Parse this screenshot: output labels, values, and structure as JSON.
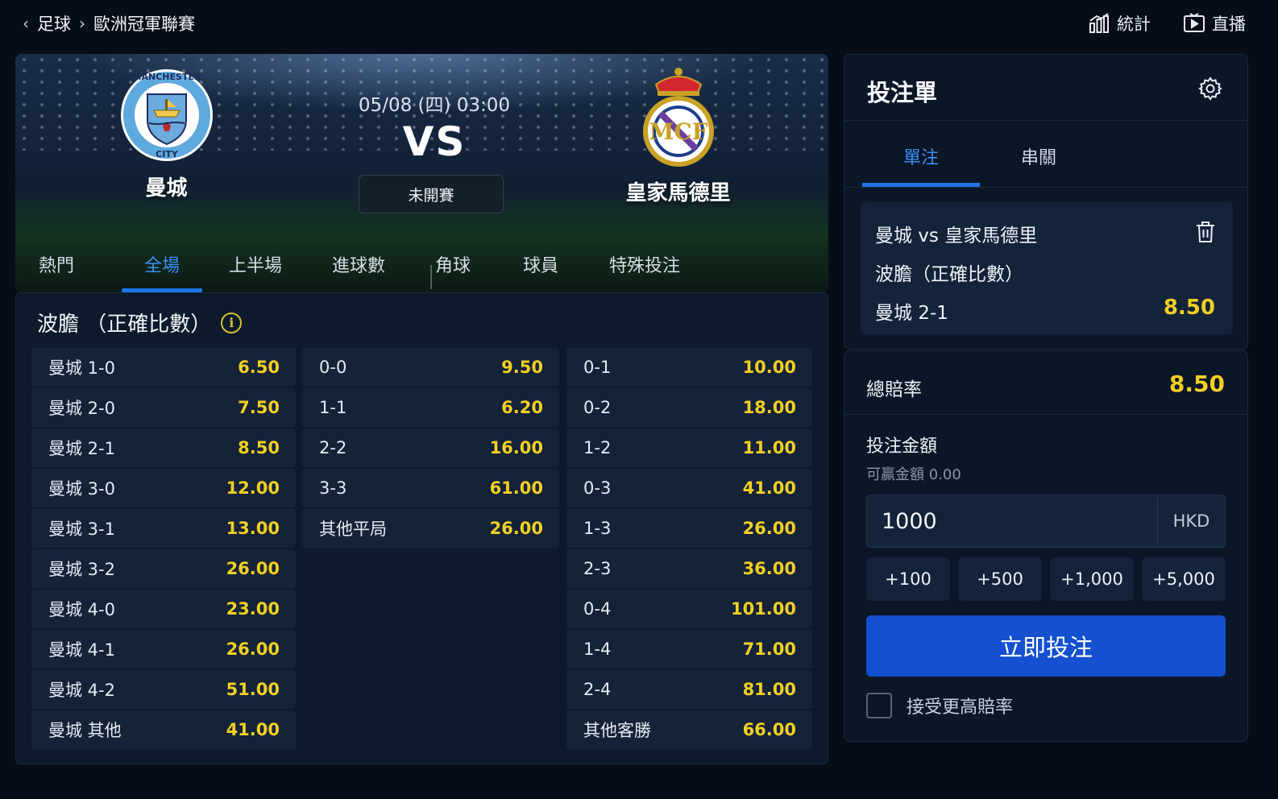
{
  "breadcrumb": {
    "sport": "足球",
    "league": "歐洲冠軍聯賽"
  },
  "top_actions": {
    "stats": "統計",
    "live": "直播"
  },
  "match": {
    "datetime": "05/08 (四) 03:00",
    "vs": "VS",
    "status": "未開賽",
    "home": {
      "name": "曼城",
      "crest_text": "MANCHESTER CITY"
    },
    "away": {
      "name": "皇家馬德里",
      "crest_text": "MCF"
    }
  },
  "market_tabs": [
    {
      "label": "熱門",
      "active": false
    },
    {
      "label": "全場",
      "active": true
    },
    {
      "label": "上半場",
      "active": false
    },
    {
      "label": "進球數",
      "active": false
    },
    {
      "label": "角球",
      "active": false
    },
    {
      "label": "球員",
      "active": false
    },
    {
      "label": "特殊投注",
      "active": false
    }
  ],
  "odds": {
    "title": "波膽 （正確比數）",
    "home_wins": [
      {
        "sel": "曼城 1-0",
        "price": "6.50"
      },
      {
        "sel": "曼城 2-0",
        "price": "7.50"
      },
      {
        "sel": "曼城 2-1",
        "price": "8.50"
      },
      {
        "sel": "曼城 3-0",
        "price": "12.00"
      },
      {
        "sel": "曼城 3-1",
        "price": "13.00"
      },
      {
        "sel": "曼城 3-2",
        "price": "26.00"
      },
      {
        "sel": "曼城 4-0",
        "price": "23.00"
      },
      {
        "sel": "曼城 4-1",
        "price": "26.00"
      },
      {
        "sel": "曼城 4-2",
        "price": "51.00"
      },
      {
        "sel": "曼城 其他",
        "price": "41.00"
      }
    ],
    "draws": [
      {
        "sel": "0-0",
        "price": "9.50"
      },
      {
        "sel": "1-1",
        "price": "6.20"
      },
      {
        "sel": "2-2",
        "price": "16.00"
      },
      {
        "sel": "3-3",
        "price": "61.00"
      },
      {
        "sel": "其他平局",
        "price": "26.00"
      }
    ],
    "away_wins": [
      {
        "sel": "0-1",
        "price": "10.00"
      },
      {
        "sel": "0-2",
        "price": "18.00"
      },
      {
        "sel": "1-2",
        "price": "11.00"
      },
      {
        "sel": "0-3",
        "price": "41.00"
      },
      {
        "sel": "1-3",
        "price": "26.00"
      },
      {
        "sel": "2-3",
        "price": "36.00"
      },
      {
        "sel": "0-4",
        "price": "101.00"
      },
      {
        "sel": "1-4",
        "price": "71.00"
      },
      {
        "sel": "2-4",
        "price": "81.00"
      },
      {
        "sel": "其他客勝",
        "price": "66.00"
      }
    ]
  },
  "betslip": {
    "title": "投注單",
    "tabs": [
      {
        "label": "單注",
        "active": true
      },
      {
        "label": "串關",
        "active": false
      }
    ],
    "bet": {
      "match": "曼城 vs 皇家馬德里",
      "market": "波膽（正確比數）",
      "pick": "曼城 2-1",
      "odds": "8.50"
    },
    "total_odds_label": "總賠率",
    "total_odds": "8.50",
    "stake_label": "投注金額",
    "potential_win": "可贏金額 0.00",
    "stake_value": "1000",
    "currency": "HKD",
    "quick_amounts": [
      "+100",
      "+500",
      "+1,000",
      "+5,000"
    ],
    "place_bet": "立即投注",
    "accept_higher": "接受更高賠率"
  },
  "colors": {
    "accent": "#1f74e8",
    "odds": "#f2cf23",
    "background": "#070d18",
    "place_button": "#1450d0"
  },
  "icons": [
    "chevron-left-icon",
    "chevron-right-icon",
    "stats-icon",
    "live-play-icon",
    "info-icon",
    "gear-icon",
    "trash-icon"
  ]
}
